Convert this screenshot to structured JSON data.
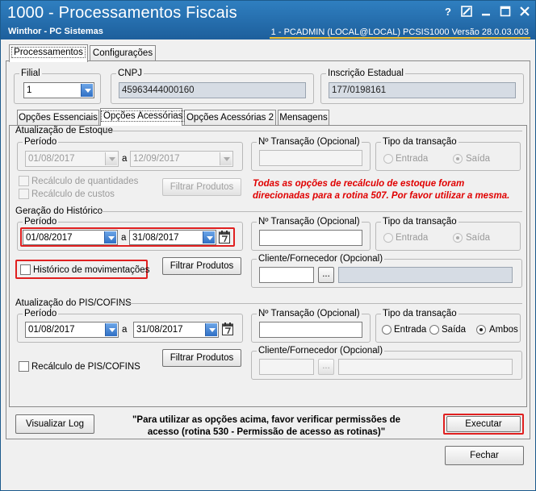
{
  "window": {
    "title": "1000 - Processamentos Fiscais",
    "company": "Winthor - PC Sistemas",
    "status": "1 - PCADMIN (LOCAL@LOCAL)   PCSIS1000  Versão  28.0.03.003",
    "help_glyph": "?"
  },
  "main_tabs": [
    {
      "label": "Processamentos"
    },
    {
      "label": "Configurações"
    }
  ],
  "filial": {
    "label": "Filial",
    "value": "1"
  },
  "cnpj": {
    "label": "CNPJ",
    "value": "45963444000160"
  },
  "ie": {
    "label": "Inscrição Estadual",
    "value": "177/0198161"
  },
  "sub_tabs": [
    {
      "label": "Opções Essenciais"
    },
    {
      "label": "Opções Acessórias"
    },
    {
      "label": "Opções Acessórias 2"
    },
    {
      "label": "Mensagens"
    }
  ],
  "estoque": {
    "title": "Atualização de Estoque",
    "periodo_label": "Período",
    "date_from": "01/08/2017",
    "sep": "a",
    "date_to": "12/09/2017",
    "transacao_label": "Nº Transação (Opcional)",
    "tipo_label": "Tipo da transação",
    "radio_entrada": "Entrada",
    "radio_saida": "Saída",
    "recalc_qtd": "Recálculo de quantidades",
    "recalc_custos": "Recálculo de custos",
    "filtrar": "Filtrar Produtos",
    "note_line1": "Todas as opções de recálculo de estoque foram",
    "note_line2": "direcionadas para a rotina 507. Por favor utilizar a mesma."
  },
  "historico": {
    "title": "Geração do Histórico",
    "periodo_label": "Período",
    "date_from": "01/08/2017",
    "sep": "a",
    "date_to": "31/08/2017",
    "transacao_label": "Nº Transação (Opcional)",
    "tipo_label": "Tipo da transação",
    "radio_entrada": "Entrada",
    "radio_saida": "Saída",
    "check_label": "Histórico de movimentações",
    "filtrar": "Filtrar Produtos",
    "cliente_label": "Cliente/Fornecedor (Opcional)",
    "ellipsis": "..."
  },
  "piscofins": {
    "title": "Atualização do PIS/COFINS",
    "periodo_label": "Período",
    "date_from": "01/08/2017",
    "sep": "a",
    "date_to": "31/08/2017",
    "transacao_label": "Nº Transação (Opcional)",
    "tipo_label": "Tipo da transação",
    "radio_entrada": "Entrada",
    "radio_saida": "Saída",
    "radio_ambos": "Ambos",
    "filtrar": "Filtrar Produtos",
    "check_label": "Recálculo de PIS/COFINS",
    "cliente_label": "Cliente/Fornecedor (Opcional)",
    "ellipsis": "..."
  },
  "footer": {
    "visualizar_log": "Visualizar Log",
    "msg_line1": "\"Para utilizar as opções acima, favor verificar permissões de",
    "msg_line2": "acesso (rotina 530 - Permissão de acesso as rotinas)\"",
    "executar": "Executar",
    "fechar": "Fechar"
  },
  "colors": {
    "titlebar": "#2f7fc0",
    "highlight_red": "#e02020",
    "note_red": "#e00000"
  }
}
